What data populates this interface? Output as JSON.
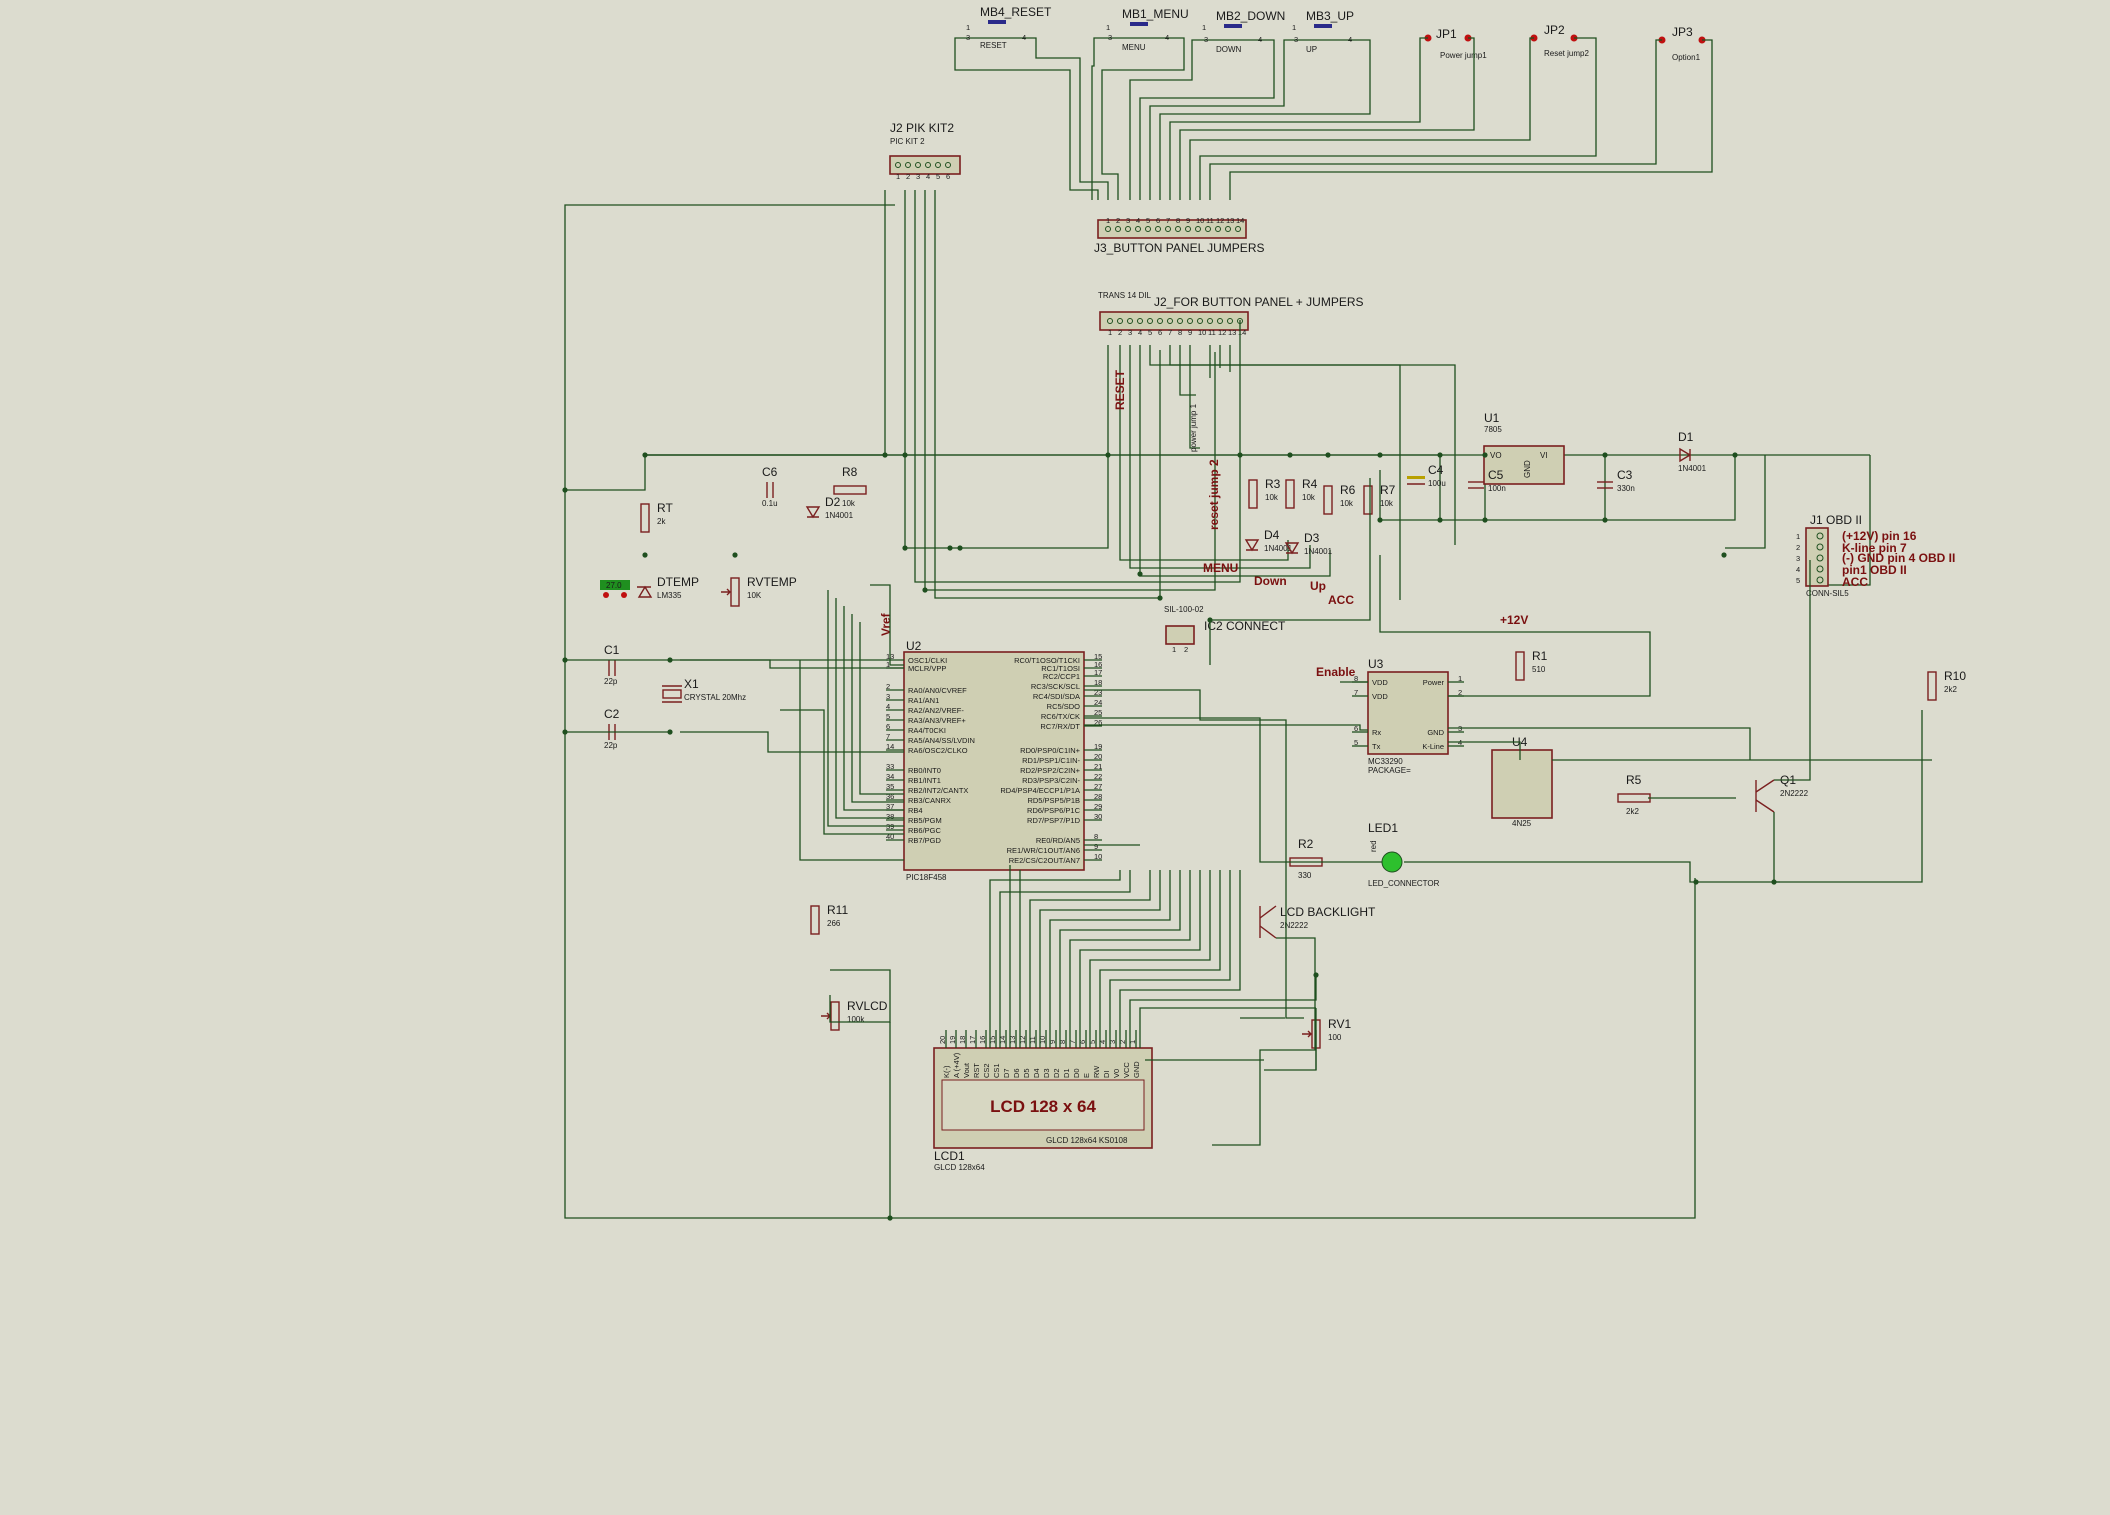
{
  "schematic": {
    "buttons": [
      {
        "ref": "MB4_RESET",
        "value": "RESET"
      },
      {
        "ref": "MB1_MENU",
        "value": "MENU"
      },
      {
        "ref": "MB2_DOWN",
        "value": "DOWN"
      },
      {
        "ref": "MB3_UP",
        "value": "UP"
      }
    ],
    "jumpers": [
      {
        "ref": "JP1",
        "value": "Power jump1"
      },
      {
        "ref": "JP2",
        "value": "Reset jump2"
      },
      {
        "ref": "JP3",
        "value": "Option1"
      }
    ],
    "connectors": {
      "j2_pickit": {
        "ref": "J2 PIK KIT2",
        "value": "PIC KIT 2"
      },
      "j3": {
        "ref": "J3_BUTTON PANEL JUMPERS"
      },
      "j2_panel": {
        "ref": "J2_FOR BUTTON PANEL + JUMPERS",
        "value": "TRANS 14 DIL"
      },
      "j1": {
        "ref": "J1 OBD II",
        "value": "CONN-SIL5"
      },
      "ic2": {
        "ref": "IC2 CONNECT",
        "value": "SIL-100-02"
      }
    },
    "obd_pins": [
      "(+12V)  pin 16",
      "K-line  pin 7",
      "(-)  GND pin 4 OBD II",
      "pin1 OBD II",
      "ACC"
    ],
    "net_labels": {
      "reset": "RESET",
      "power_jump": "power jump 1",
      "reset_jump": "reset jump 2",
      "menu": "MENU",
      "down": "Down",
      "up": "Up",
      "acc": "ACC",
      "vref": "Vref",
      "plus12v": "+12V",
      "enable": "Enable"
    },
    "passives": [
      {
        "ref": "C6",
        "value": "0.1u"
      },
      {
        "ref": "R8",
        "value": "10k"
      },
      {
        "ref": "D2",
        "value": "1N4001"
      },
      {
        "ref": "RT",
        "value": "2k"
      },
      {
        "ref": "DTEMP",
        "value": "LM335"
      },
      {
        "ref": "RVTEMP",
        "value": "10K"
      },
      {
        "ref": "C1",
        "value": "22p"
      },
      {
        "ref": "C2",
        "value": "22p"
      },
      {
        "ref": "X1",
        "value": "CRYSTAL 20Mhz"
      },
      {
        "ref": "R3",
        "value": "10k"
      },
      {
        "ref": "R4",
        "value": "10k"
      },
      {
        "ref": "R6",
        "value": "10k"
      },
      {
        "ref": "R7",
        "value": "10k"
      },
      {
        "ref": "D4",
        "value": "1N4001"
      },
      {
        "ref": "D3",
        "value": "1N4001"
      },
      {
        "ref": "C4",
        "value": "100u"
      },
      {
        "ref": "C5",
        "value": "100n"
      },
      {
        "ref": "C3",
        "value": "330n"
      },
      {
        "ref": "D1",
        "value": "1N4001"
      },
      {
        "ref": "R1",
        "value": "510"
      },
      {
        "ref": "R10",
        "value": "2k2"
      },
      {
        "ref": "R5",
        "value": "2k2"
      },
      {
        "ref": "R2",
        "value": "330"
      },
      {
        "ref": "R11",
        "value": "266"
      },
      {
        "ref": "RV1",
        "value": "100"
      },
      {
        "ref": "RVLCD",
        "value": "100k"
      }
    ],
    "u1": {
      "ref": "U1",
      "value": "7805",
      "pins": [
        "VO",
        "VI",
        "GND"
      ]
    },
    "u2": {
      "ref": "U2",
      "value": "PIC18F458",
      "left_pins": [
        {
          "n": "13",
          "name": "OSC1/CLKI"
        },
        {
          "n": "1",
          "name": "MCLR/VPP"
        },
        {
          "n": "2",
          "name": "RA0/AN0/CVREF"
        },
        {
          "n": "3",
          "name": "RA1/AN1"
        },
        {
          "n": "4",
          "name": "RA2/AN2/VREF-"
        },
        {
          "n": "5",
          "name": "RA3/AN3/VREF+"
        },
        {
          "n": "6",
          "name": "RA4/T0CKI"
        },
        {
          "n": "7",
          "name": "RA5/AN4/SS/LVDIN"
        },
        {
          "n": "14",
          "name": "RA6/OSC2/CLKO"
        },
        {
          "n": "33",
          "name": "RB0/INT0"
        },
        {
          "n": "34",
          "name": "RB1/INT1"
        },
        {
          "n": "35",
          "name": "RB2/INT2/CANTX"
        },
        {
          "n": "36",
          "name": "RB3/CANRX"
        },
        {
          "n": "37",
          "name": "RB4"
        },
        {
          "n": "38",
          "name": "RB5/PGM"
        },
        {
          "n": "39",
          "name": "RB6/PGC"
        },
        {
          "n": "40",
          "name": "RB7/PGD"
        }
      ],
      "right_pins": [
        {
          "n": "15",
          "name": "RC0/T1OSO/T1CKI"
        },
        {
          "n": "16",
          "name": "RC1/T1OSI"
        },
        {
          "n": "17",
          "name": "RC2/CCP1"
        },
        {
          "n": "18",
          "name": "RC3/SCK/SCL"
        },
        {
          "n": "23",
          "name": "RC4/SDI/SDA"
        },
        {
          "n": "24",
          "name": "RC5/SDO"
        },
        {
          "n": "25",
          "name": "RC6/TX/CK"
        },
        {
          "n": "26",
          "name": "RC7/RX/DT"
        },
        {
          "n": "19",
          "name": "RD0/PSP0/C1IN+"
        },
        {
          "n": "20",
          "name": "RD1/PSP1/C1IN-"
        },
        {
          "n": "21",
          "name": "RD2/PSP2/C2IN+"
        },
        {
          "n": "22",
          "name": "RD3/PSP3/C2IN-"
        },
        {
          "n": "27",
          "name": "RD4/PSP4/ECCP1/P1A"
        },
        {
          "n": "28",
          "name": "RD5/PSP5/P1B"
        },
        {
          "n": "29",
          "name": "RD6/PSP6/P1C"
        },
        {
          "n": "30",
          "name": "RD7/PSP7/P1D"
        },
        {
          "n": "8",
          "name": "RE0/RD/AN5"
        },
        {
          "n": "9",
          "name": "RE1/WR/C1OUT/AN6"
        },
        {
          "n": "10",
          "name": "RE2/CS/C2OUT/AN7"
        }
      ]
    },
    "u3": {
      "ref": "U3",
      "value": "MC33290",
      "package": "PACKAGE=",
      "left_pins": [
        "VDD",
        "VDD",
        "Rx",
        "Tx"
      ],
      "left_nums": [
        "8",
        "7",
        "6",
        "5"
      ],
      "right_pins": [
        "Power",
        "",
        "GND",
        "K-Line"
      ],
      "right_nums": [
        "1",
        "2",
        "3",
        "4"
      ]
    },
    "u4": {
      "ref": "U4",
      "value": "4N25"
    },
    "q1": {
      "ref": "Q1",
      "value": "2N2222"
    },
    "lcd_backlight": {
      "ref": "LCD BACKLIGHT",
      "value": "2N2222"
    },
    "led1": {
      "ref": "LED1",
      "value": "LED_CONNECTOR",
      "tag": "red"
    },
    "lcd1": {
      "ref": "LCD1",
      "value": "GLCD 128x64",
      "title": "LCD 128 x 64",
      "footer": "GLCD 128x64  KS0108",
      "pin_names": [
        "K(-)",
        "A (+4V)",
        "Vout",
        "RST",
        "CS2",
        "CS1",
        "D7",
        "D6",
        "D5",
        "D4",
        "D3",
        "D2",
        "D1",
        "D0",
        "E",
        "RW",
        "DI",
        "V0",
        "VCC",
        "GND"
      ],
      "pin_nums": [
        "20",
        "19",
        "18",
        "17",
        "16",
        "15",
        "14",
        "13",
        "12",
        "11",
        "10",
        "9",
        "8",
        "7",
        "6",
        "5",
        "4",
        "3",
        "2",
        "1"
      ]
    },
    "ic2_pins": [
      "1",
      "2"
    ],
    "j1_pins": [
      "1",
      "2",
      "3",
      "4",
      "5"
    ],
    "dtemp_tag": "27.0"
  }
}
